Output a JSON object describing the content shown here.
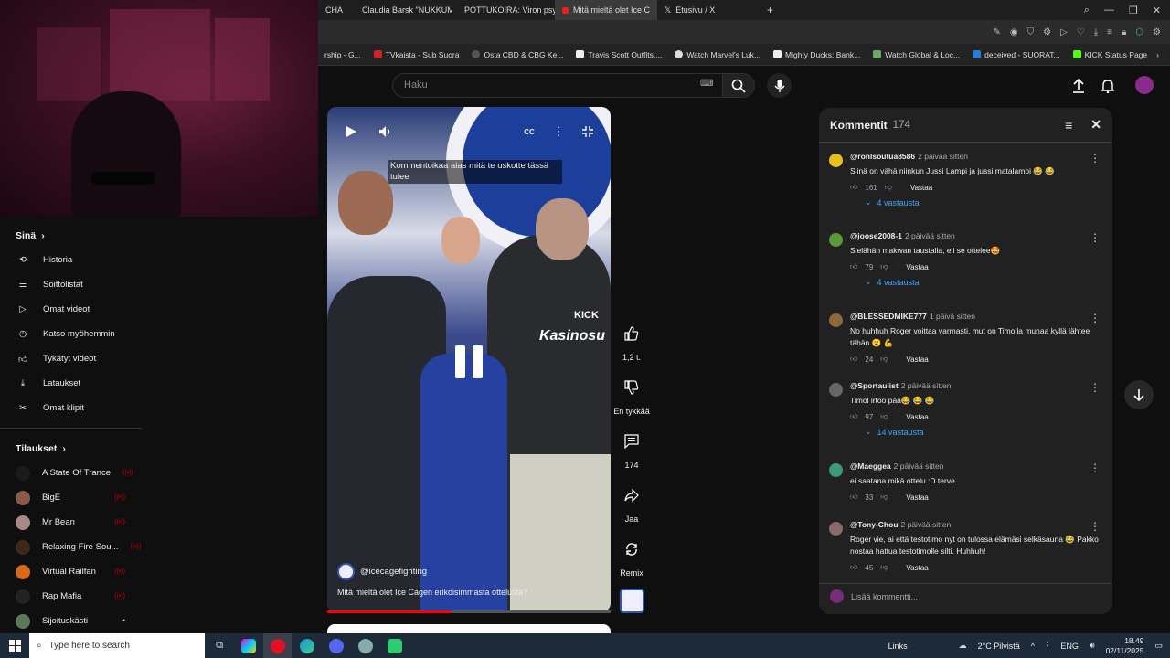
{
  "browser": {
    "tabs": [
      {
        "label": "CHA"
      },
      {
        "label": "Claudia Barsk \"NUKKUMA"
      },
      {
        "label": "POTTUKOIRA: Viron psyko"
      },
      {
        "label": "Mitä mieltä olet Ice C"
      },
      {
        "label": "Etusivu / X"
      }
    ],
    "new_tab": "+",
    "bookmarks": [
      "rship - G...",
      "TVkaista - Sub Suora",
      "Osta CBD & CBG Ke...",
      "Travis Scott Outfits,...",
      "Watch Marvel's Luk...",
      "Mighty Ducks: Bank...",
      "Watch Global & Loc...",
      "deceived - SUORAT...",
      "KICK Status Page"
    ]
  },
  "header": {
    "search_placeholder": "Haku"
  },
  "sidebar": {
    "you_title": "Sinä",
    "you_items": [
      {
        "label": "Historia",
        "icon": "history-icon"
      },
      {
        "label": "Soittolistat",
        "icon": "playlist-icon"
      },
      {
        "label": "Omat videot",
        "icon": "video-icon"
      },
      {
        "label": "Katso myöhemmin",
        "icon": "clock-icon"
      },
      {
        "label": "Tykätyt videot",
        "icon": "like-icon"
      },
      {
        "label": "Lataukset",
        "icon": "download-icon"
      },
      {
        "label": "Omat klipit",
        "icon": "scissors-icon"
      }
    ],
    "subs_title": "Tilaukset",
    "subs": [
      {
        "label": "A State Of Trance",
        "color": "#1b1b1b",
        "live": "((•))"
      },
      {
        "label": "BigE",
        "color": "#8a5a4a",
        "live": "((•))"
      },
      {
        "label": "Mr Bean",
        "color": "#a88",
        "live": "((•))"
      },
      {
        "label": "Relaxing Fire Sou...",
        "color": "#3b2a1a",
        "live": "((•))"
      },
      {
        "label": "Virtual Railfan",
        "color": "#d86a1a",
        "live": "((•))"
      },
      {
        "label": "Rap Mafia",
        "color": "#222",
        "live": "((•))"
      },
      {
        "label": "Sijoituskästi",
        "color": "#5a7a5a",
        "live": "•"
      }
    ]
  },
  "video": {
    "caption": "Kommentoikaa alas mitä te uskotte tässä tulee",
    "channel": "@icecagefighting",
    "title": "Mitä mieltä olet Ice Cagen erikoisimmasta ottelusta? ",
    "progress": 0.44,
    "overlay_text": "KICK",
    "overlay_text2": "Kasinosu"
  },
  "actions": {
    "likes": "1,2 t.",
    "dislike": "En tykkää",
    "comments": "174",
    "share": "Jaa",
    "remix": "Remix"
  },
  "comments": {
    "title": "Kommentit",
    "count": "174",
    "add_placeholder": "Lisää kommentti...",
    "items": [
      {
        "user": "@ronlsoutua8586",
        "time": "2 päivää sitten",
        "text": "Siinä on vähä niinkun Jussi Lampi ja jussi matalampi 😂 😂",
        "likes": "161",
        "reply": "Vastaa",
        "replies": "4 vastausta",
        "color": "#e8c020"
      },
      {
        "user": "@joose2008-1",
        "time": "2 päivää sitten",
        "text": "Sielähän makwan taustalla, eli se ottelee🤩",
        "likes": "79",
        "reply": "Vastaa",
        "replies": "4 vastausta",
        "color": "#5a9a3a"
      },
      {
        "user": "@BLESSEDMIKE777",
        "time": "1 päivä sitten",
        "text": "No huhhuh Roger voittaa varmasti, mut on Timolla munaa kyllä lähtee tähän 😮 💪",
        "likes": "24",
        "reply": "Vastaa",
        "replies": "",
        "color": "#8a6a3a"
      },
      {
        "user": "@Sportaulist",
        "time": "2 päivää sitten",
        "text": "Timol irtoo pää😂 😂 😂",
        "likes": "97",
        "reply": "Vastaa",
        "replies": "14 vastausta",
        "color": "#666"
      },
      {
        "user": "@Maeggea",
        "time": "2 päivää sitten",
        "text": "ei saatana mikä ottelu :D terve",
        "likes": "33",
        "reply": "Vastaa",
        "replies": "",
        "color": "#3a9a7a"
      },
      {
        "user": "@Tony-Chou",
        "time": "2 päivää sitten",
        "text": "Roger vie, ai että testotimo nyt on tulossa elämäsi selkäsauna 😂 Pakko nostaa hattua testotimolle silti. Huhhuh!",
        "likes": "45",
        "reply": "Vastaa",
        "replies": "",
        "color": "#8a6a6a"
      }
    ]
  },
  "taskbar": {
    "search_placeholder": "Type here to search",
    "links": "Links",
    "weather": "2°C Pilvistä",
    "lang": "ENG",
    "time": "18.49",
    "date": "02/11/2025"
  }
}
